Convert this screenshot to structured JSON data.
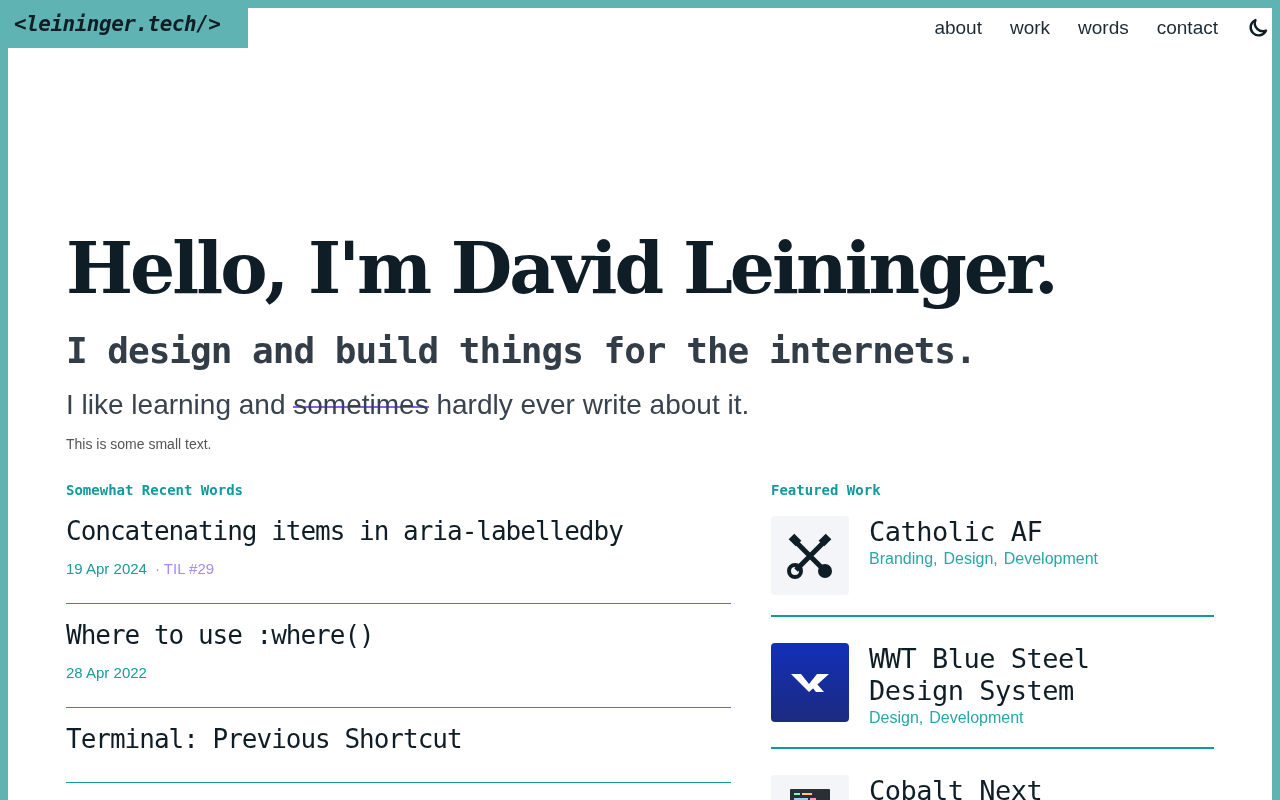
{
  "header": {
    "logo": "<leininger.tech/>",
    "nav": [
      "about",
      "work",
      "words",
      "contact"
    ],
    "theme_toggle": {
      "kind": "moon"
    }
  },
  "hero": {
    "title": "Hello, I'm David Leininger.",
    "subtitle": "I design and build things for the internets.",
    "intro": {
      "before": "I like learning and",
      "struck": "sometimes",
      "after": "hardly ever write about it."
    },
    "small_text": "This is some small text."
  },
  "words": {
    "heading": "Somewhat Recent Words",
    "posts": [
      {
        "title": "Concatenating items in aria-labelledby",
        "date": "19 Apr 2024",
        "tag": "· TIL #29"
      },
      {
        "title": "Where to use :where()",
        "date": "28 Apr 2022"
      },
      {
        "title": "Terminal: Previous Shortcut"
      }
    ]
  },
  "work": {
    "heading": "Featured Work",
    "items": [
      {
        "title": "Catholic AF",
        "tags": [
          "Branding,",
          "Design,",
          "Development"
        ],
        "kind": "keys"
      },
      {
        "title": "WWT Blue Steel Design System",
        "tags": [
          "Design,",
          "Development"
        ],
        "kind": "chevron"
      },
      {
        "title": "Cobalt Next",
        "kind": "editor"
      }
    ]
  }
}
